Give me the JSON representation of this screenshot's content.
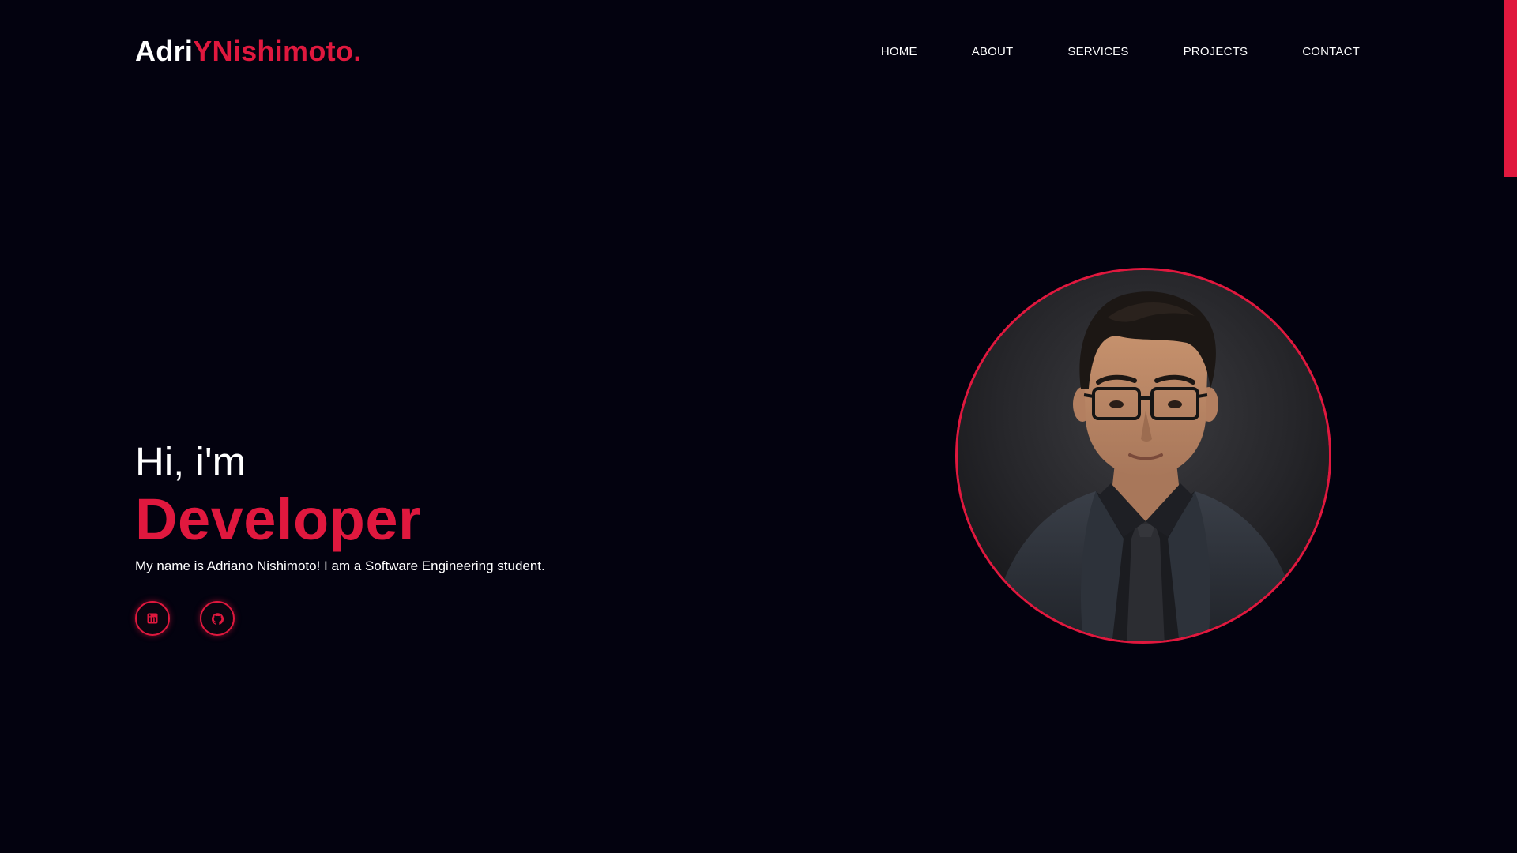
{
  "header": {
    "logo_part1": "Adri",
    "logo_part2": "YNishimoto."
  },
  "nav": {
    "items": [
      {
        "label": "HOME"
      },
      {
        "label": "ABOUT"
      },
      {
        "label": "SERVICES"
      },
      {
        "label": "PROJECTS"
      },
      {
        "label": "CONTACT"
      }
    ]
  },
  "hero": {
    "greeting": "Hi, i'm",
    "role": "Developer",
    "intro": "My name is Adriano Nishimoto! I am a Software Engineering student.",
    "socials": [
      {
        "icon": "linkedin-icon"
      },
      {
        "icon": "github-icon"
      }
    ]
  },
  "portrait": {
    "icon": "profile-photo"
  },
  "colors": {
    "background": "#03020f",
    "accent": "#e0183e",
    "text": "#ffffff"
  }
}
